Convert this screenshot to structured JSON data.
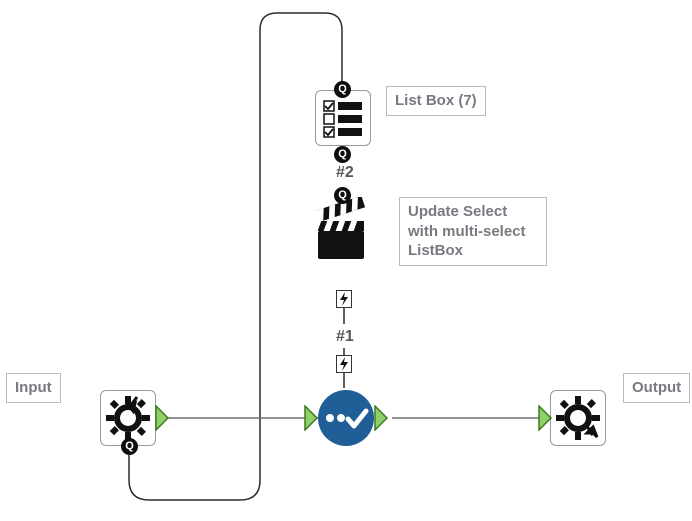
{
  "labels": {
    "input": "Input",
    "output": "Output",
    "listbox": "List Box (7)",
    "action": "Update Select with multi-select ListBox",
    "hash1": "#1",
    "hash2": "#2"
  },
  "badges": {
    "q": "Q"
  },
  "icons": {
    "flash": "⚡"
  },
  "colors": {
    "main_node": "#1f5e96",
    "accent": "#8fd06a"
  }
}
